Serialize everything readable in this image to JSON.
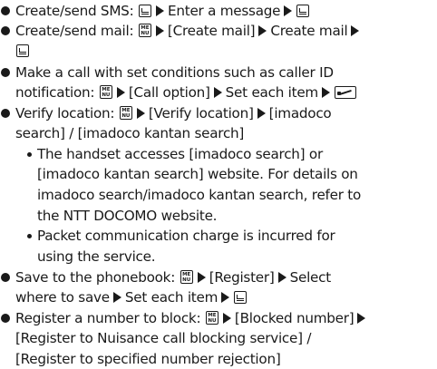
{
  "items": [
    {
      "label": "Create/send SMS:",
      "steps": [
        "Enter a message"
      ]
    },
    {
      "label": "Create/send mail:",
      "steps": [
        "[Create mail]",
        "Create mail"
      ]
    },
    {
      "label_line1": "Make a call with set conditions such as caller ID",
      "label_line2": "notification:",
      "steps": [
        "[Call option]",
        "Set each item"
      ]
    },
    {
      "label": "Verify location:",
      "steps": [
        "[Verify location]",
        "[imadoco"
      ],
      "cont": "search] / [imadoco kantan search]",
      "notes": [
        [
          "The handset accesses [imadoco search] or",
          "[imadoco kantan search] website. For details on",
          "imadoco search/imadoco kantan search, refer to",
          "the NTT DOCOMO website."
        ],
        [
          "Packet communication charge is incurred for",
          "using the service."
        ]
      ]
    },
    {
      "label": "Save to the phonebook:",
      "steps": [
        "[Register]",
        "Select"
      ],
      "cont_steps": [
        "where to save",
        "Set each item"
      ]
    },
    {
      "label": "Register a number to block:",
      "steps": [
        "[Blocked number]"
      ],
      "cont1": "[Register to Nuisance call blocking service] /",
      "cont2": "[Register to specified number rejection]"
    }
  ],
  "icons": {
    "mail_key": "mail-key-icon",
    "menu_key_top": "ME",
    "menu_key_bottom": "NU",
    "call_key": "call-key-icon",
    "arrow": "triangle-right-icon"
  }
}
